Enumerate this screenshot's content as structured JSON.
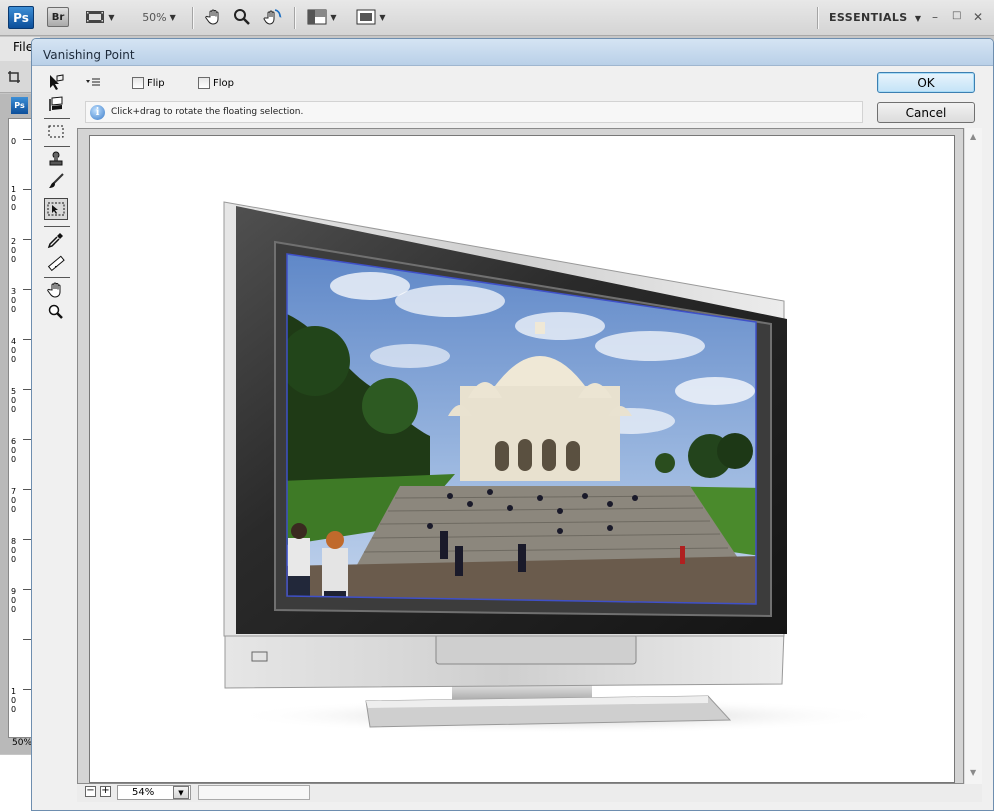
{
  "app": {
    "logo": "Ps",
    "bridge": "Br",
    "zoom": "50%",
    "workspace": "ESSENTIALS",
    "window_controls": {
      "minimize": "–",
      "restore": "□",
      "close": "✕"
    },
    "menu_file": "File",
    "doc_logo": "Ps",
    "doc_zoom": "50%"
  },
  "ruler": {
    "labels": [
      "0",
      "100",
      "200",
      "300",
      "400",
      "500",
      "600",
      "700",
      "800",
      "900",
      "100"
    ]
  },
  "dialog": {
    "title": "Vanishing Point",
    "flip_label": "Flip",
    "flop_label": "Flop",
    "info_text": "Click+drag to rotate the floating selection.",
    "ok_label": "OK",
    "cancel_label": "Cancel",
    "zoom_value": "54%",
    "zoom_minus": "−",
    "zoom_plus": "+"
  },
  "tools": [
    "edit-plane-icon",
    "create-plane-icon",
    "marquee-icon",
    "stamp-icon",
    "brush-icon",
    "transform-icon",
    "eyedropper-icon",
    "measure-icon",
    "hand-icon",
    "zoom-icon"
  ],
  "colors": {
    "dialog_title_bg": "#c7dbef",
    "ok_accent": "#3c7fb1",
    "ps_blue": "#1a6fc0"
  }
}
